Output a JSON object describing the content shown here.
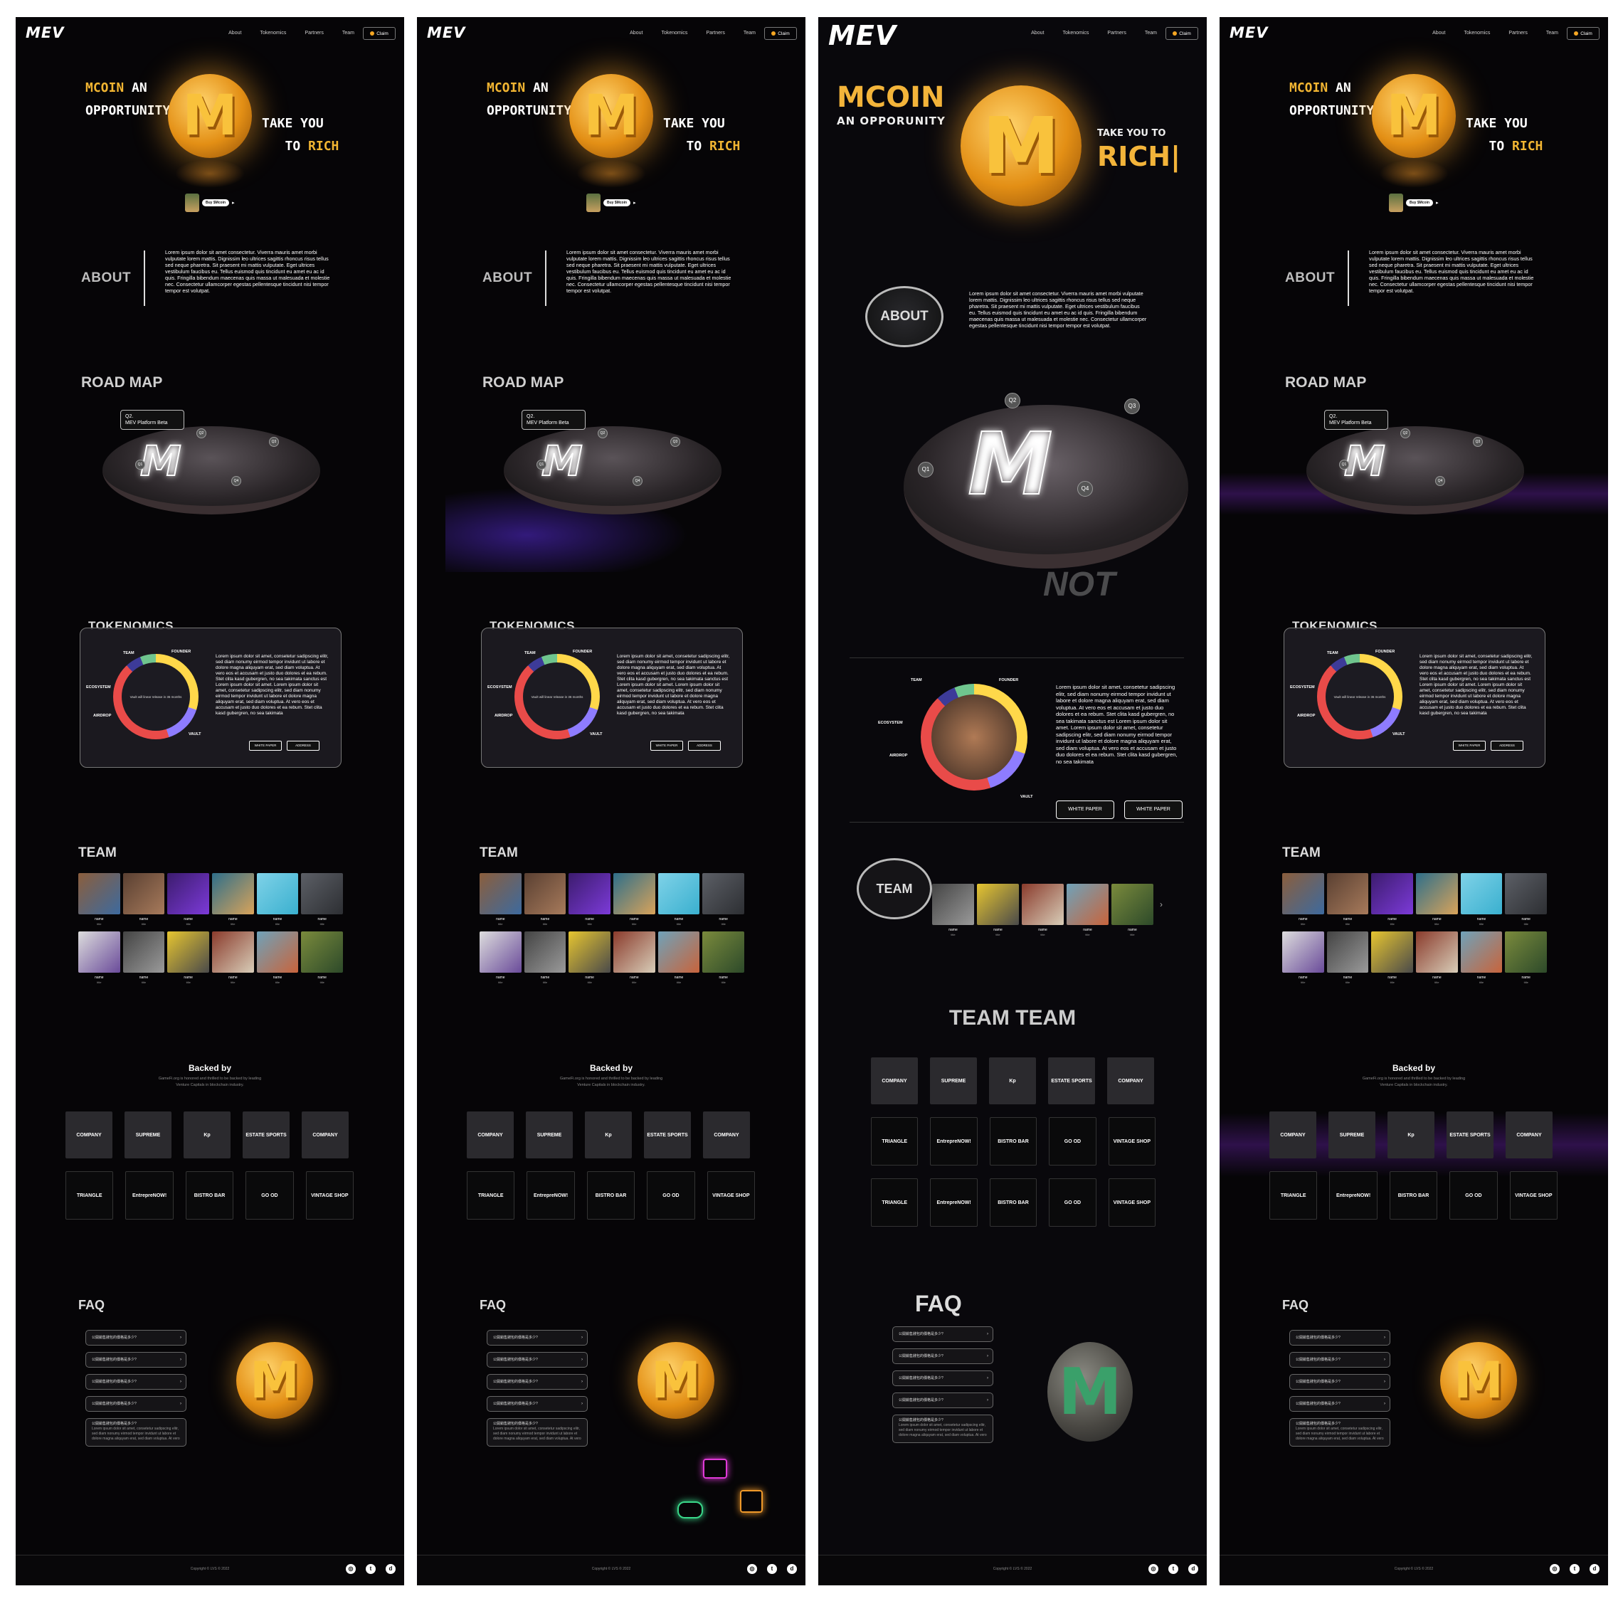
{
  "nav": {
    "logo": "MEV",
    "links": [
      "About",
      "Tokenomics",
      "Partners",
      "Team"
    ],
    "claim": "Claim"
  },
  "hero": {
    "line1_gold": "MCOIN",
    "line1_rest": " AN",
    "line2": "OPPORTUNITY",
    "line3": "TAKE YOU",
    "line4_a": "TO ",
    "line4_gold": "RICH",
    "coin_letter": "M",
    "buy_label": "Buy $Mcoin",
    "p3_title": "MCOIN",
    "p3_sub": "AN OPPORUNITY",
    "p3_take": "TAKE YOU TO",
    "p3_rich": "RICH|"
  },
  "about": {
    "heading": "ABOUT",
    "text": "Lorem ipsum dolor sit amet consectetur. Viverra mauris amet morbi vulputate lorem mattis. Dignissim leo ultrices sagittis rhoncus risus tellus sed neque pharetra. Sit praesent mi mattis vulputate. Eget ultrices vestibulum faucibus eu. Tellus euismod quis tincidunt eu amet eu ac id quis. Fringilla bibendum maecenas quis massa ut malesuada et molestie nec. Consectetur ullamcorper egestas pellentesque tincidunt nisi tempor tempor est volutpat."
  },
  "roadmap": {
    "heading": "ROAD MAP",
    "tag_q": "Q2.",
    "tag_text": "MEV Platform Beta",
    "q1": "Q1",
    "q2": "Q2",
    "q3": "Q3",
    "q4": "Q4"
  },
  "tokenomics": {
    "heading": "TOKENOMICS",
    "labels": {
      "team": "TEAM",
      "founder": "FOUNDER",
      "ecosystem": "ECOSYSTEM",
      "airdrop": "AIRDROP",
      "vault": "VAULT"
    },
    "center": "Vault will linear release in 36 months",
    "text": "Lorem ipsum dolor sit amet, consetetur sadipscing elitr, sed diam nonumy eirmod tempor invidunt ut labore et dolore magna aliquyam erat, sed diam voluptua. At vero eos et accusam et justo duo dolores et ea rebum. Stet clita kasd gubergren, no sea takimata sanctus est Lorem ipsum dolor sit amet. Lorem ipsum dolor sit amet, consetetur sadipscing elitr, sed diam nonumy eirmod tempor invidunt ut labore et dolore magna aliquyam erat, sed diam voluptua. At vero eos et accusam et justo duo dolores et ea rebum. Stet clita kasd gubergren, no sea takimata",
    "btn_white": "WHITE PAPER",
    "btn_address": "ADDRESS",
    "btn_white2": "WHITE PAPER"
  },
  "team": {
    "heading": "TEAM",
    "member_name": "name",
    "member_title": "title",
    "p3_heading": "TEAM TEAM"
  },
  "backed": {
    "heading": "Backed by",
    "sub1": "GameFi.org is honored and thrilled to be backed by leading",
    "sub2": "Venture Capitals in blockchain industry.",
    "row1": [
      "COMPANY",
      "SUPREME",
      "Kp",
      "ESTATE SPORTS",
      "COMPANY"
    ],
    "row2": [
      "TRIANGLE",
      "EntrepreNOW!",
      "BISTRO BAR",
      "GO OD",
      "VINTAGE SHOP"
    ]
  },
  "faq": {
    "heading": "FAQ",
    "question": "公開銷售錢包的價格是多少?",
    "answer": "Lorem ipsum dolor sit amet, consetetur sadipscing elitr, sed diam nonumy eirmod tempor invidunt ut labore et dolore magna aliquyam erat, sed diam voluptua. At vero"
  },
  "footer": {
    "copyright": "Copyright © LVS © 2022",
    "socials": [
      "instagram-icon",
      "twitter-icon",
      "discord-icon"
    ]
  },
  "colors": {
    "gold": "#f1b532",
    "purple": "#7a28c8",
    "bg": "#060507"
  }
}
